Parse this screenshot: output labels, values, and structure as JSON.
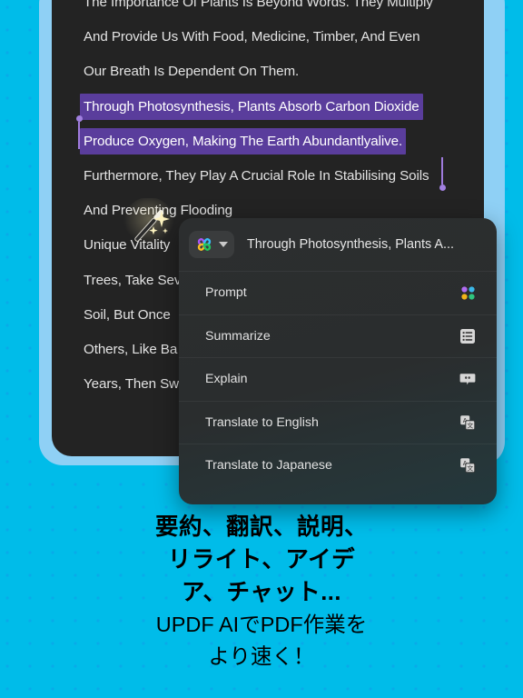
{
  "background": {
    "color": "#00bce9",
    "dot_color": "#2a6ee6"
  },
  "document": {
    "card_color": "#232323",
    "frame_color": "#8fd0f5",
    "lines": [
      {
        "text": "The Importance Of Plants Is Beyond Words. They Multiply",
        "highlighted": false
      },
      {
        "text": "And Provide Us With Food, Medicine, Timber, And Even",
        "highlighted": false
      },
      {
        "text": "Our Breath Is Dependent On Them.",
        "highlighted": false
      },
      {
        "text": "Through Photosynthesis, Plants Absorb Carbon Dioxide",
        "highlighted": true
      },
      {
        "text": "Produce Oxygen, Making The Earth Abundantlyalive.",
        "highlighted": true
      },
      {
        "text": "Furthermore, They Play A Crucial Role In Stabilising Soils",
        "highlighted": false
      },
      {
        "text": "And Preventing Flooding",
        "highlighted": false
      },
      {
        "text": "Unique Vitality",
        "highlighted": false
      },
      {
        "text": "Trees, Take Sev",
        "highlighted": false
      },
      {
        "text": "Soil, But Once",
        "highlighted": false
      },
      {
        "text": "Others, Like Ba",
        "highlighted": false
      },
      {
        "text": "Years, Then Sw",
        "highlighted": false
      }
    ],
    "selection_color": "#5a3d9c",
    "handle_color": "#a180e0"
  },
  "cursor": {
    "icon": "magic-wand-icon"
  },
  "ai_panel": {
    "brand_icon": "updf-clover-logo-icon",
    "dropdown_icon": "chevron-down-icon",
    "title": "Through Photosynthesis, Plants A...",
    "items": [
      {
        "label": "Prompt",
        "icon": "four-dots-icon"
      },
      {
        "label": "Summarize",
        "icon": "list-lines-icon"
      },
      {
        "label": "Explain",
        "icon": "speech-bubble-icon"
      },
      {
        "label": "Translate to English",
        "icon": "translate-icon"
      },
      {
        "label": "Translate to Japanese",
        "icon": "translate-icon"
      }
    ],
    "brand_colors": {
      "purple": "#a855f7",
      "blue": "#38bdf8",
      "yellow": "#fbbf24",
      "green": "#22c55e"
    }
  },
  "caption": {
    "line1": "要約、翻訳、説明、",
    "line2": "リライト、アイデ",
    "line3": "ア、チャット...",
    "line4": "UPDF AIでPDF作業を",
    "line5": "より速く！"
  }
}
